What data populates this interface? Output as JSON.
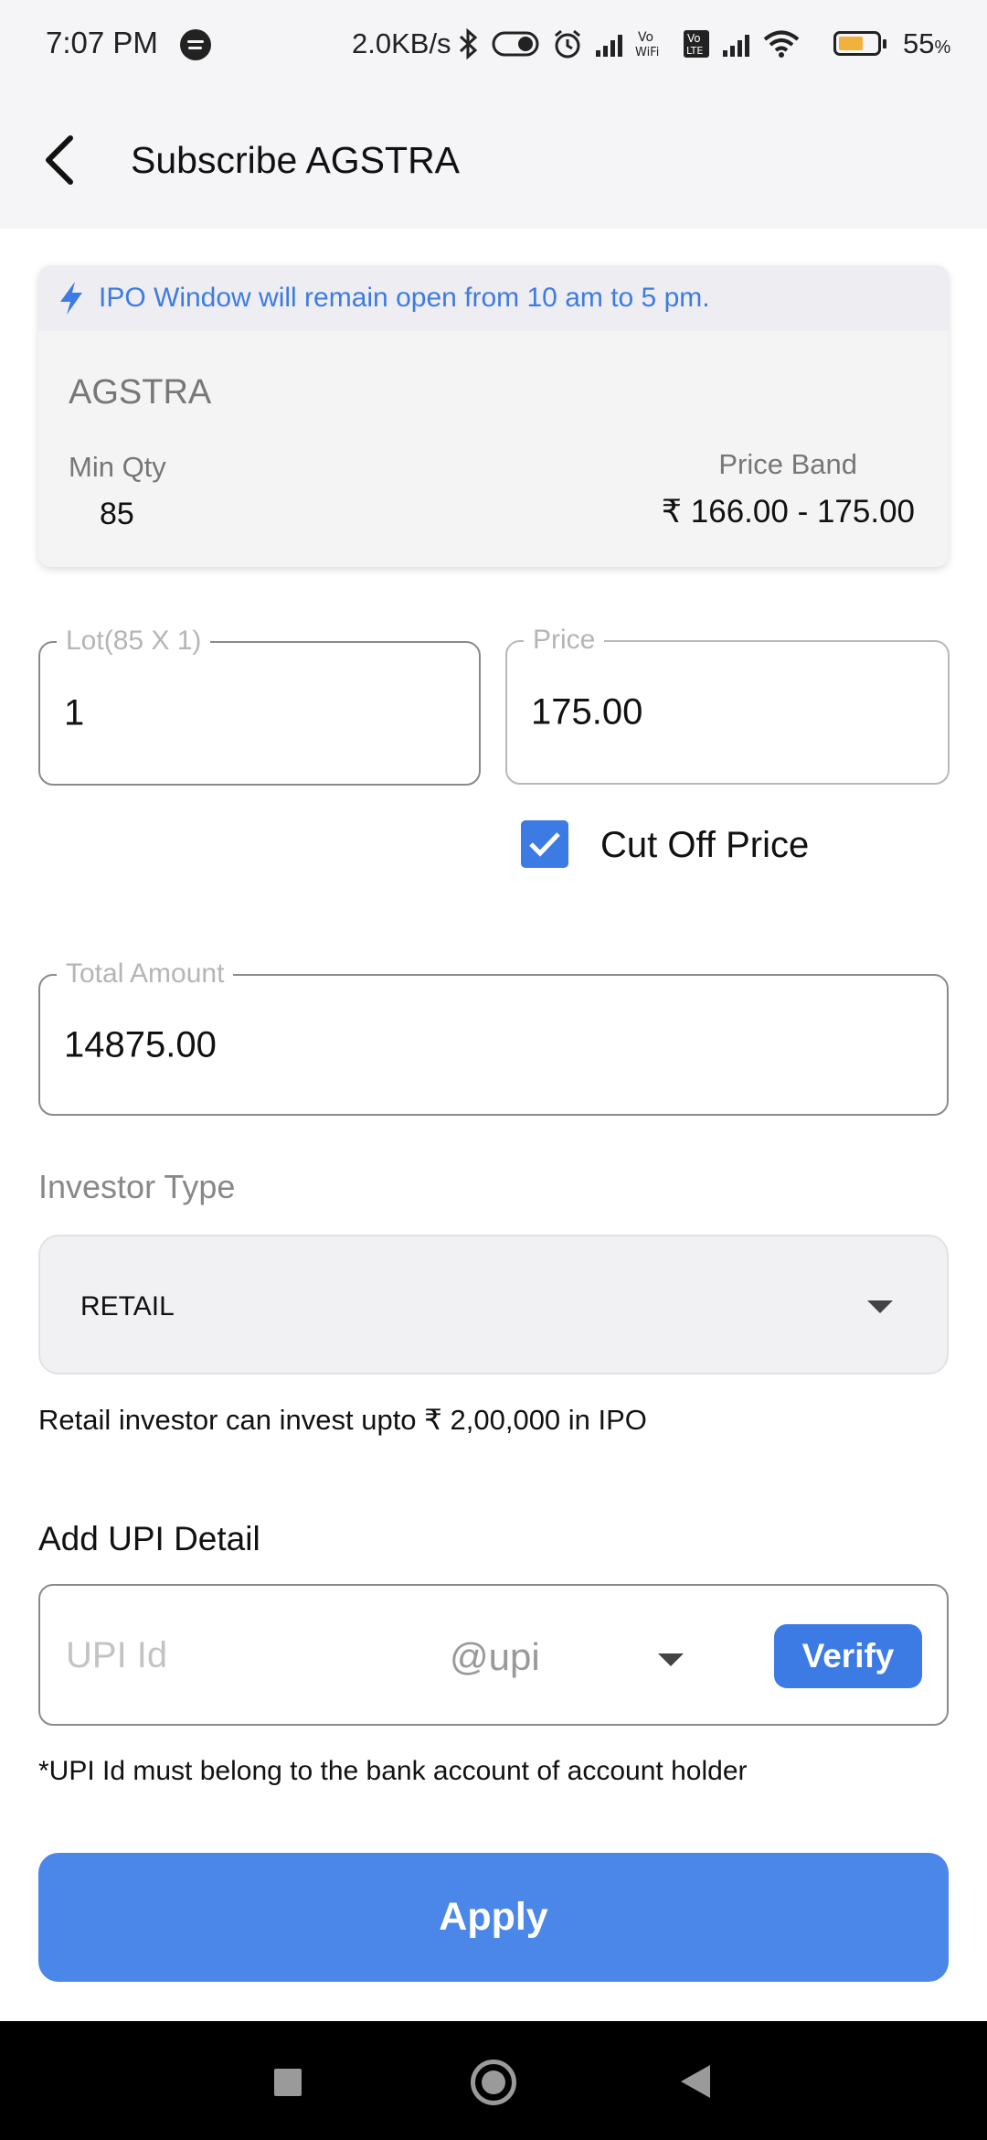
{
  "status_bar": {
    "time": "7:07 PM",
    "network_speed": "2.0KB/s",
    "vowifi": "Vo\nWiFi",
    "volte": "Vo\nLTE",
    "battery_percent": "55",
    "battery_unit": "%",
    "battery_level": 0.55
  },
  "header": {
    "title": "Subscribe AGSTRA"
  },
  "ipo": {
    "notice": "IPO Window will remain open from 10 am to 5 pm.",
    "symbol": "AGSTRA",
    "min_qty_label": "Min Qty",
    "min_qty_value": "85",
    "price_band_label": "Price Band",
    "price_band_value": "₹ 166.00 - 175.00"
  },
  "form": {
    "lot_label": "Lot(85 X 1)",
    "lot_value": "1",
    "price_label": "Price",
    "price_value": "175.00",
    "cutoff_label": "Cut Off Price",
    "cutoff_checked": true,
    "total_label": "Total Amount",
    "total_value": "14875.00",
    "investor_type_label": "Investor Type",
    "investor_type_value": "RETAIL",
    "investor_helper": "Retail investor can invest upto ₹ 2,00,000 in IPO"
  },
  "upi": {
    "title": "Add UPI Detail",
    "placeholder": "UPI Id",
    "handle": "@upi",
    "verify_label": "Verify",
    "note": "*UPI Id must belong to the bank account of account holder"
  },
  "apply_label": "Apply"
}
